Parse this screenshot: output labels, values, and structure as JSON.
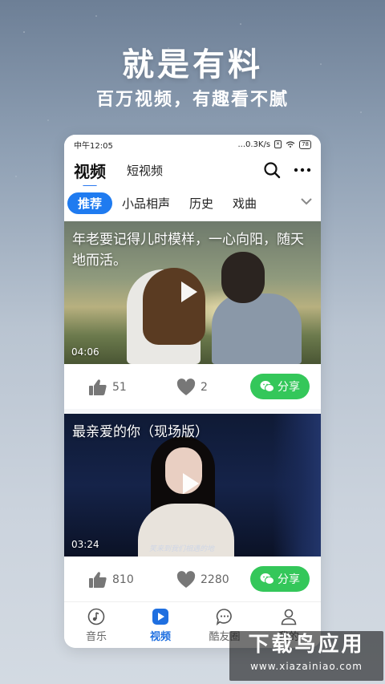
{
  "promo": {
    "headline": "就是有料",
    "subline": "百万视频，有趣看不腻"
  },
  "status_bar": {
    "time": "中午12:05",
    "speed": "...0.3K/s",
    "battery": "78"
  },
  "top_nav": {
    "tab_video": "视频",
    "tab_short_video": "短视频"
  },
  "categories": [
    "推荐",
    "小品相声",
    "历史",
    "戏曲"
  ],
  "videos": [
    {
      "caption": "年老要记得儿时模样，一心向阳，随天地而活。",
      "duration": "04:06",
      "likes": "51",
      "favorites": "2",
      "share_label": "分享"
    },
    {
      "caption": "最亲爱的你（现场版）",
      "duration": "03:24",
      "subtitle": "笑来到我们相遇的地",
      "likes": "810",
      "favorites": "2280",
      "share_label": "分享"
    }
  ],
  "bottom_nav": [
    "音乐",
    "视频",
    "酷友圈",
    "我的"
  ],
  "watermark": {
    "title": "下载鸟应用",
    "url": "www.xiazainiao.com"
  },
  "colors": {
    "accent": "#1f7bf0",
    "share_green": "#34c75a"
  }
}
